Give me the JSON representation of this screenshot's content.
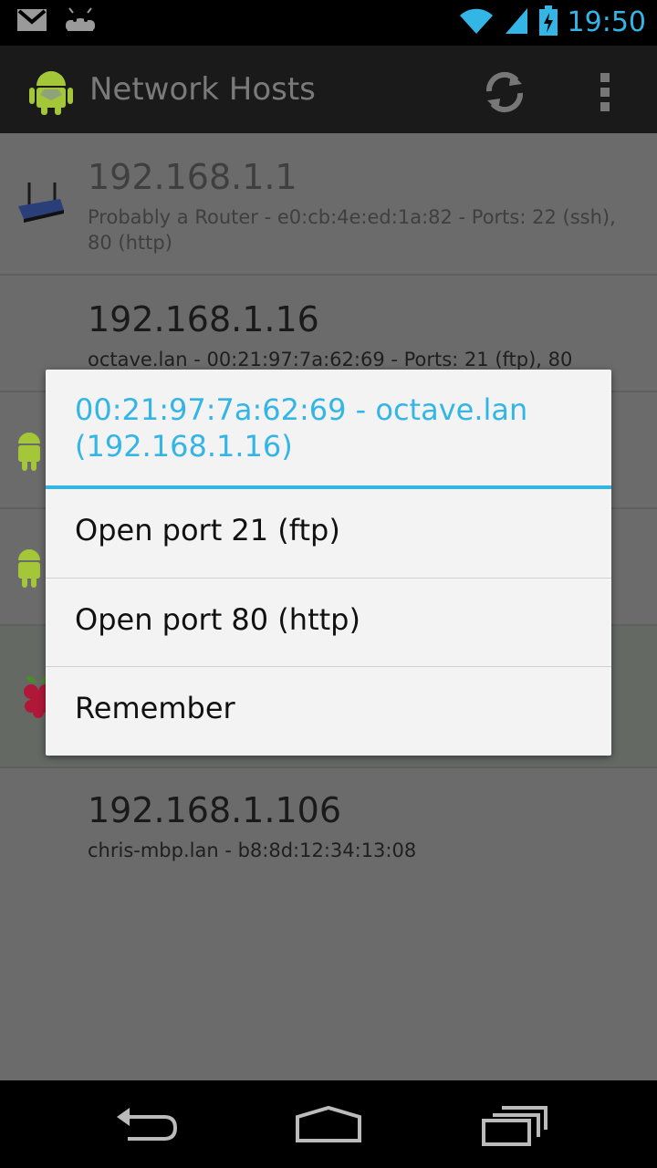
{
  "status_bar": {
    "time": "19:50",
    "icons": [
      "gmail-icon",
      "android-notification-icon",
      "wifi-icon",
      "signal-icon",
      "battery-charging-icon"
    ]
  },
  "action_bar": {
    "title": "Network Hosts",
    "icons": [
      "app-android-icon",
      "refresh-icon",
      "overflow-menu-icon"
    ]
  },
  "hosts": [
    {
      "ip": "192.168.1.1",
      "detail": "Probably a Router - e0:cb:4e:ed:1a:82 - Ports: 22 (ssh), 80 (http)",
      "icon": "router-icon"
    },
    {
      "ip": "192.168.1.16",
      "detail": "octave.lan - 00:21:97:7a:62:69 - Ports: 21 (ftp), 80 (http)",
      "icon": ""
    },
    {
      "ip": "",
      "detail": "",
      "icon": "android-icon"
    },
    {
      "ip": "",
      "detail": "",
      "icon": "android-icon"
    },
    {
      "ip": "",
      "detail": "",
      "icon": "raspberry-pi-icon"
    },
    {
      "ip": "192.168.1.106",
      "detail": "chris-mbp.lan - b8:8d:12:34:13:08",
      "icon": ""
    }
  ],
  "dialog": {
    "title": "00:21:97:7a:62:69 - octave.lan (192.168.1.16)",
    "items": [
      "Open port 21 (ftp)",
      "Open port 80 (http)",
      "Remember"
    ]
  },
  "nav_bar": {
    "icons": [
      "back-icon",
      "home-icon",
      "recent-apps-icon"
    ]
  },
  "colors": {
    "accent": "#33b5e5",
    "android_green": "#a4c639"
  }
}
